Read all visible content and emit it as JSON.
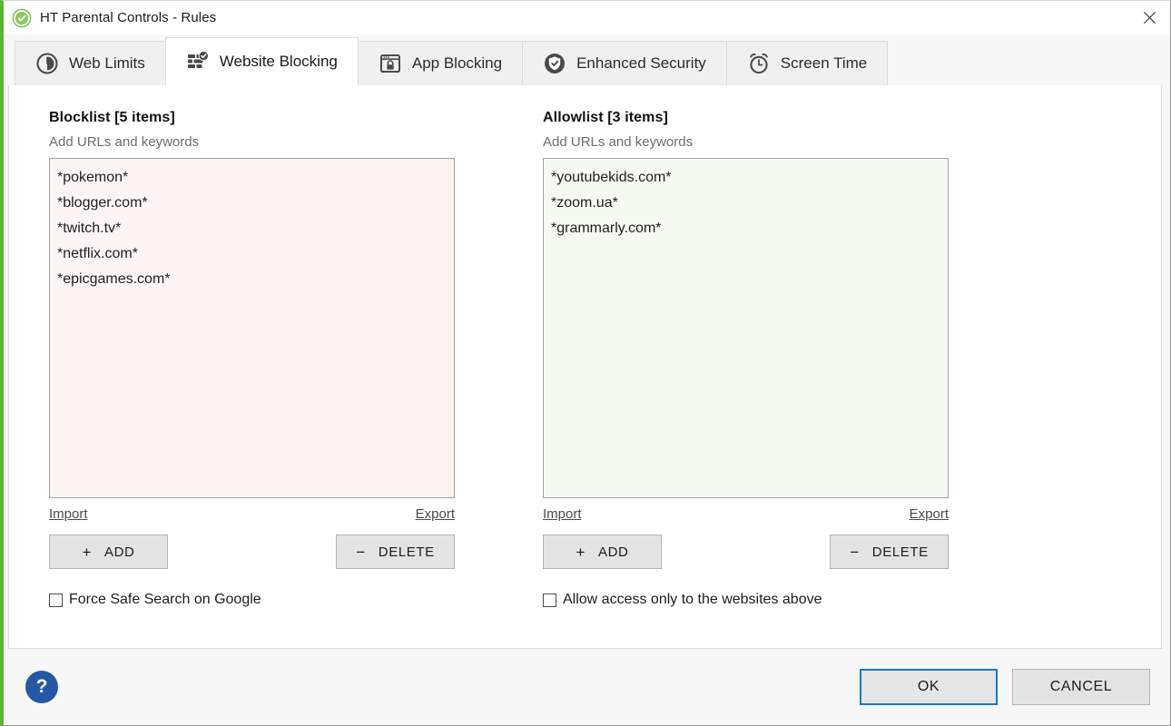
{
  "window": {
    "title": "HT Parental Controls - Rules",
    "title_icon": "shield-check-icon",
    "close_icon": "close-icon",
    "accent_color": "#5cb531"
  },
  "tabs": [
    {
      "label": "Web Limits",
      "icon": "clock-pie-icon",
      "active": false
    },
    {
      "label": "Website Blocking",
      "icon": "brick-wall-check-icon",
      "active": true
    },
    {
      "label": "App Blocking",
      "icon": "window-lock-icon",
      "active": false
    },
    {
      "label": "Enhanced Security",
      "icon": "shield-check-icon",
      "active": false
    },
    {
      "label": "Screen Time",
      "icon": "alarm-clock-icon",
      "active": false
    }
  ],
  "blocklist": {
    "title": "Blocklist [5 items]",
    "subtitle": "Add URLs and keywords",
    "items": [
      "*pokemon*",
      "*blogger.com*",
      "*twitch.tv*",
      "*netflix.com*",
      "*epicgames.com*"
    ],
    "background_color": "#fdf4f4",
    "import_label": "Import",
    "export_label": "Export",
    "add_label": "ADD",
    "add_sign": "+",
    "delete_label": "DELETE",
    "delete_sign": "−",
    "checkbox_label": "Force Safe Search on Google",
    "checkbox_checked": false
  },
  "allowlist": {
    "title": "Allowlist [3 items]",
    "subtitle": "Add URLs and keywords",
    "items": [
      "*youtubekids.com*",
      "*zoom.ua*",
      "*grammarly.com*"
    ],
    "background_color": "#f4faf2",
    "import_label": "Import",
    "export_label": "Export",
    "add_label": "ADD",
    "add_sign": "+",
    "delete_label": "DELETE",
    "delete_sign": "−",
    "checkbox_label": "Allow access only to the websites above",
    "checkbox_checked": false
  },
  "footer": {
    "help_label": "?",
    "help_icon": "question-mark-icon",
    "ok_label": "OK",
    "cancel_label": "CANCEL",
    "focus_color": "#1979c8"
  }
}
